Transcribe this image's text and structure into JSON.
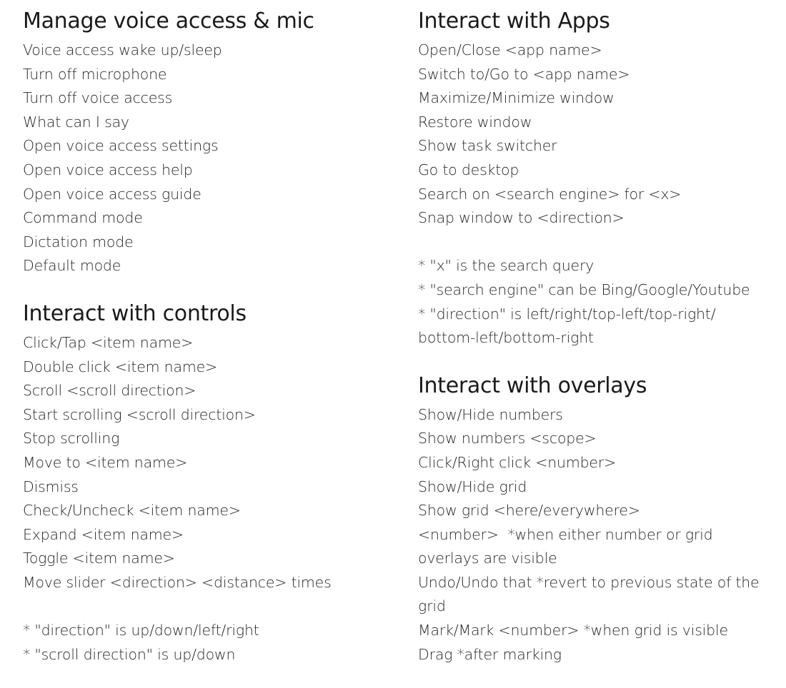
{
  "left": {
    "sections": [
      {
        "title": "Manage voice access & mic",
        "items": [
          "Voice access wake up/sleep",
          "Turn off microphone",
          "Turn off voice access",
          "What can I say",
          "Open voice access settings",
          "Open voice access help",
          "Open voice access guide",
          "Command mode",
          "Dictation mode",
          "Default mode"
        ]
      },
      {
        "title": "Interact with controls",
        "items": [
          "Click/Tap <item name>",
          "Double click <item name>",
          "Scroll <scroll direction>",
          "Start scrolling <scroll direction>",
          "Stop scrolling",
          "Move to <item name>",
          "Dismiss",
          "Check/Uncheck <item name>",
          "Expand <item name>",
          "Toggle <item name>",
          "Move slider <direction> <distance> times"
        ],
        "notes": [
          "* \"direction\" is up/down/left/right",
          "* \"scroll direction\" is up/down"
        ]
      }
    ]
  },
  "right": {
    "sections": [
      {
        "title": "Interact with Apps",
        "items": [
          "Open/Close <app name>",
          "Switch to/Go to <app name>",
          "Maximize/Minimize window",
          "Restore window",
          "Show task switcher",
          "Go to desktop",
          "Search on <search engine> for <x>",
          "Snap window to <direction>"
        ],
        "notes": [
          "* \"x\" is the search query",
          "* \"search engine\" can be Bing/Google/Youtube",
          "* \"direction\" is left/right/top-left/top-right/",
          "bottom-left/bottom-right"
        ]
      },
      {
        "title": "Interact with overlays",
        "items": [
          "Show/Hide numbers",
          "Show numbers <scope>",
          "Click/Right click <number>",
          "Show/Hide grid",
          "Show grid <here/everywhere>",
          "<number>  *when either number or grid",
          "overlays are visible",
          "Undo/Undo that *revert to previous state of the",
          "grid",
          "Mark/Mark <number> *when grid is visible",
          "Drag *after marking"
        ]
      }
    ]
  }
}
